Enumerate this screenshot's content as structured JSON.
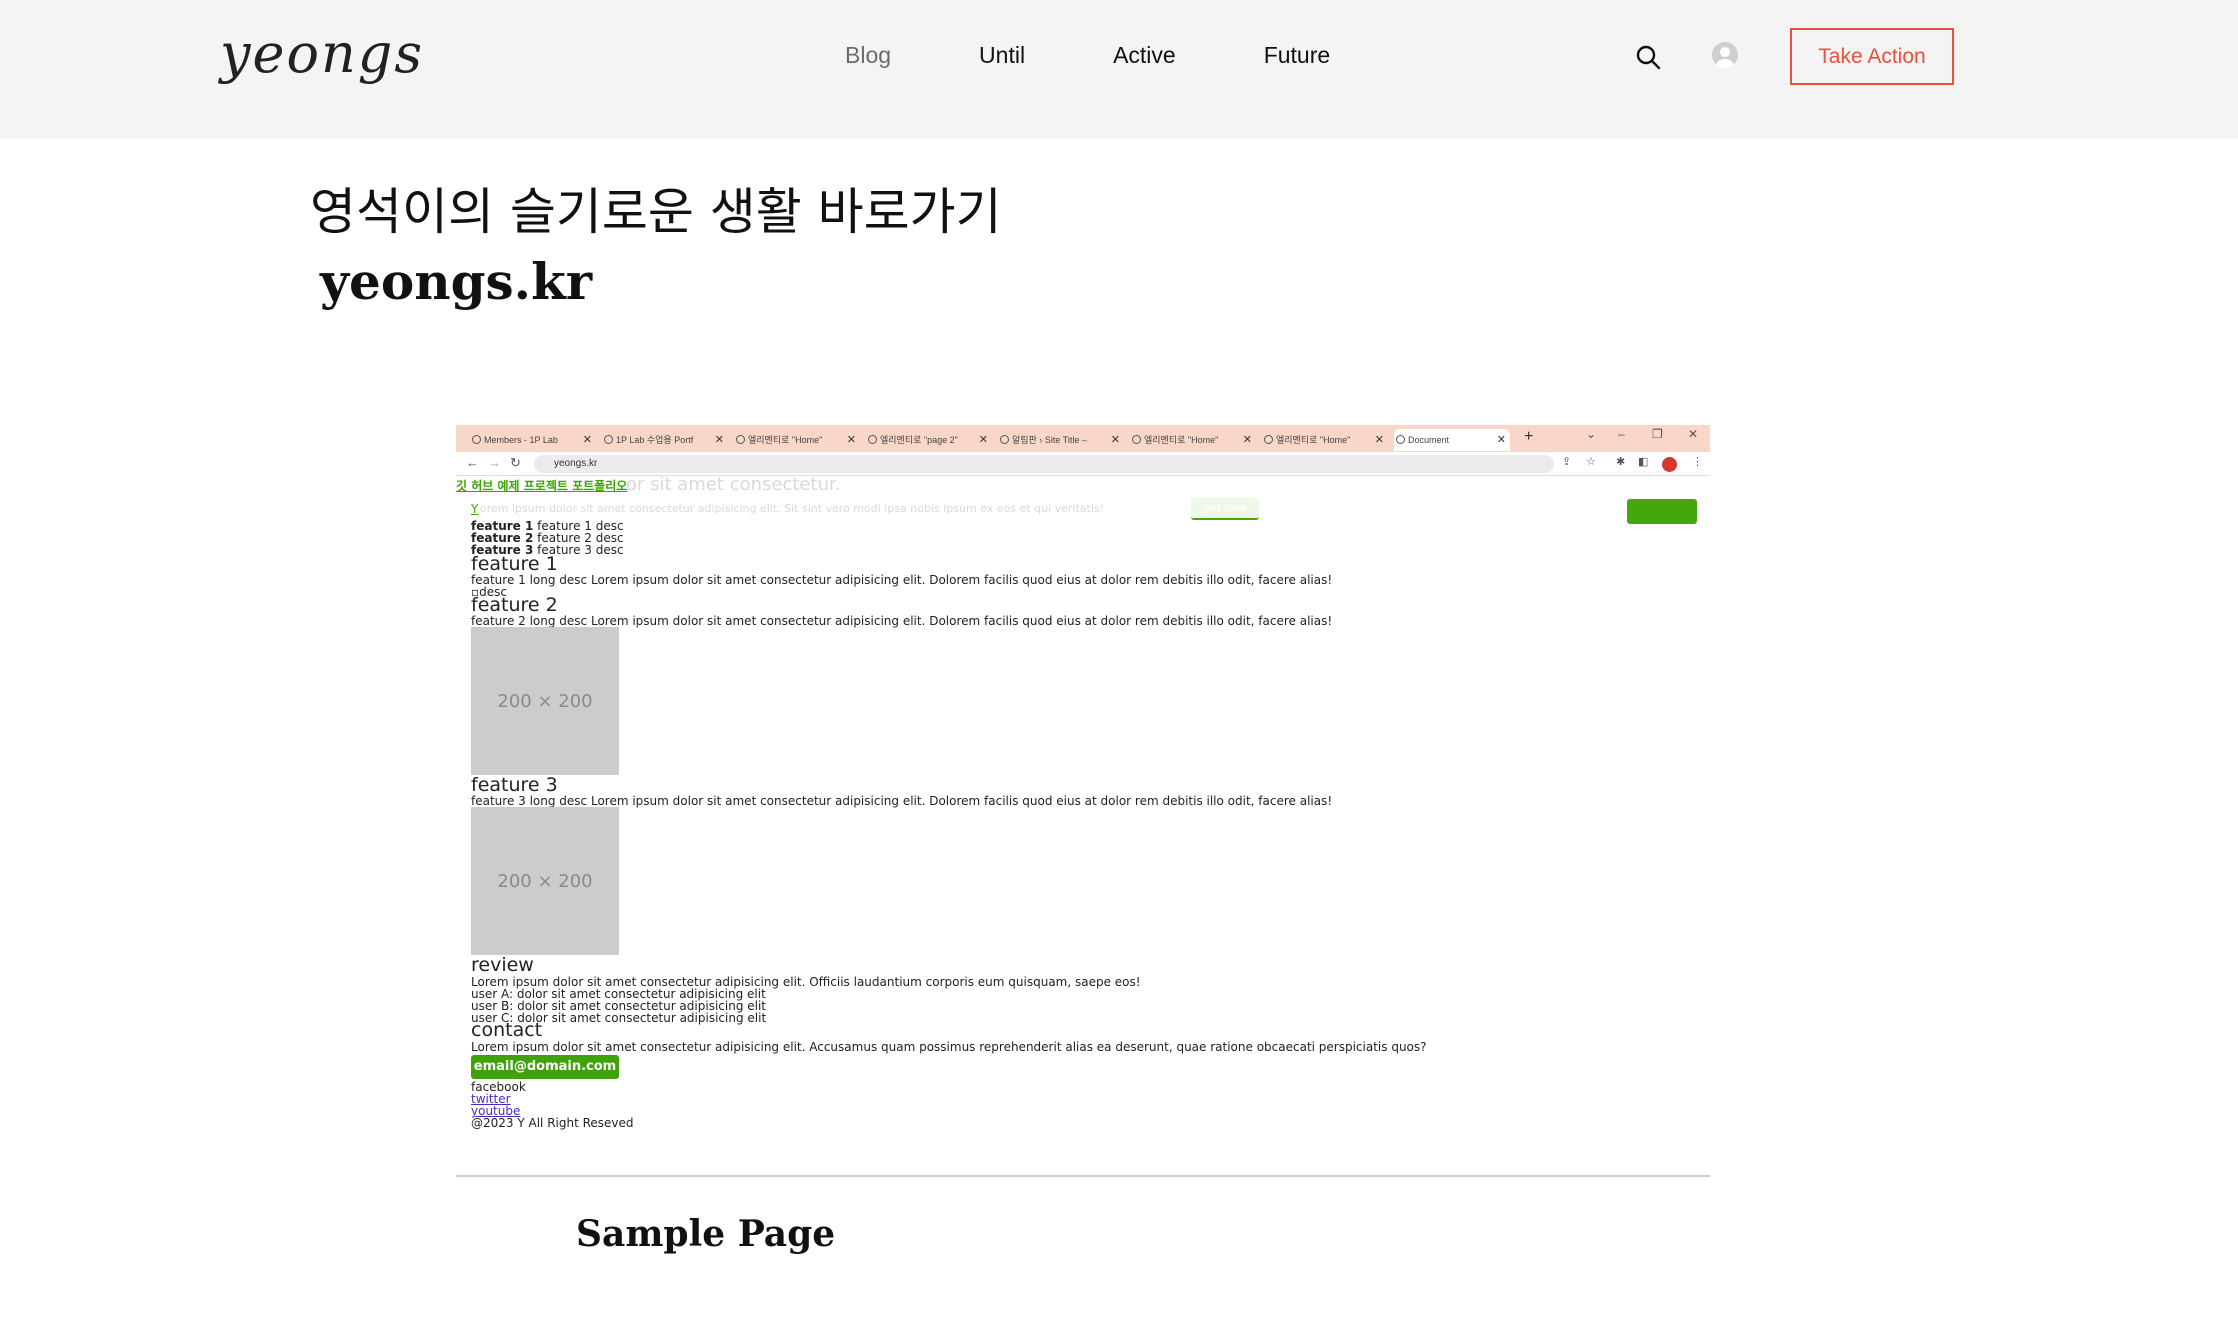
{
  "header": {
    "logo": "yeongs",
    "nav": [
      {
        "label": "Blog",
        "active": false
      },
      {
        "label": "Until",
        "active": true
      },
      {
        "label": "Active",
        "active": true
      },
      {
        "label": "Future",
        "active": true
      }
    ],
    "search_icon": "search-icon",
    "avatar_icon": "user-avatar-icon",
    "cta_label": "Take Action",
    "cta_color": "#e8513a",
    "background": "#f4f4f4"
  },
  "content": {
    "title_korean": "영석이의 슬기로운 생활 바로가기",
    "site_link": "yeongs.kr",
    "footer_heading": "Sample Page"
  },
  "screenshot": {
    "tabs": [
      "Members - 1P Lab",
      "1P Lab 수업용 Portf",
      "엘리멘티로 \"Home\"",
      "엘리멘티로 \"page 2\"",
      "알림판 › Site Title –",
      "엘리멘티로 \"Home\"",
      "엘리멘티로 \"Home\"",
      "Document"
    ],
    "url": "yeongs.kr",
    "top_link": "깃 허브 예제 프로젝트 포트폴리오",
    "ghost_heading": "or sit amet consectetur.",
    "ghost_para": "orem ipsum dolor sit amet consectetur adipisicing elit. Sit sint vero modi ipsa nobis ipsum ex eos et qui veritatis!",
    "ghost_button": "get now",
    "y_link": "Y",
    "features": [
      {
        "bold": "feature 1",
        "desc": "feature 1 desc"
      },
      {
        "bold": "feature 2",
        "desc": "feature 2 desc"
      },
      {
        "bold": "feature 3",
        "desc": "feature 3 desc"
      }
    ],
    "sections": [
      {
        "title": "feature 1",
        "long": "feature 1 long desc Lorem ipsum dolor sit amet consectetur adipisicing elit. Dolorem facilis quod eius at dolor rem debitis illo odit, facere alias!"
      },
      {
        "title": "feature 2",
        "long": "feature 2 long desc Lorem ipsum dolor sit amet consectetur adipisicing elit. Dolorem facilis quod eius at dolor rem debitis illo odit, facere alias!"
      },
      {
        "title": "feature 3",
        "long": "feature 3 long desc Lorem ipsum dolor sit amet consectetur adipisicing elit. Dolorem facilis quod eius at dolor rem debitis illo odit, facere alias!"
      }
    ],
    "broken_image_alt": "desc",
    "placeholder_label": "200 × 200",
    "review_title": "review",
    "review_text": "Lorem ipsum dolor sit amet consectetur adipisicing elit. Officiis laudantium corporis eum quisquam, saepe eos!",
    "reviews": [
      "user A: dolor sit amet consectetur adipisicing elit",
      "user B: dolor sit amet consectetur adipisicing elit",
      "user C: dolor sit amet consectetur adipisicing elit"
    ],
    "contact_title": "contact",
    "contact_text": "Lorem ipsum dolor sit amet consectetur adipisicing elit. Accusamus quam possimus reprehenderit alias ea deserunt, quae ratione obcaecati perspiciatis quos?",
    "email_button": "email@domain.com",
    "social": [
      "facebook",
      "twitter",
      "youtube"
    ],
    "copyright": "@2023 Y All Right Reseved"
  }
}
